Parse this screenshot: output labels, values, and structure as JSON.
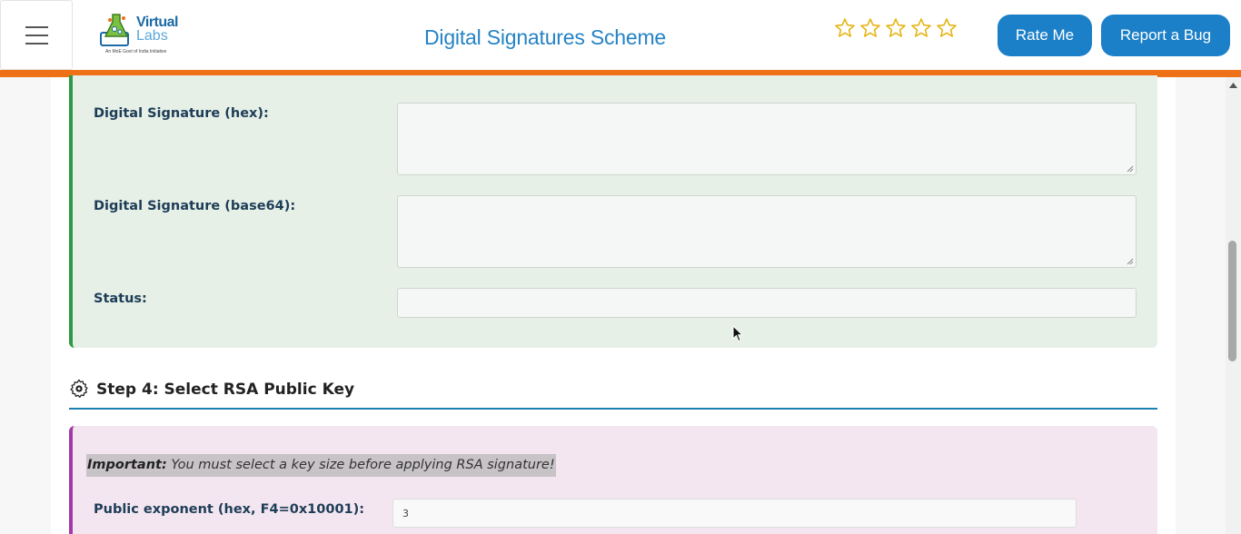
{
  "header": {
    "logo_line1": "Virtual",
    "logo_line2": "Labs",
    "logo_tagline": "An MoE Govt of India Initiative",
    "title": "Digital Signatures Scheme",
    "rating_stars": 5,
    "rate_button": "Rate Me",
    "bug_button": "Report a Bug"
  },
  "output_panel": {
    "sig_hex_label": "Digital Signature (hex):",
    "sig_hex_value": "",
    "sig_b64_label": "Digital Signature (base64):",
    "sig_b64_value": "",
    "status_label": "Status:",
    "status_value": ""
  },
  "step4": {
    "title": "Step 4: Select RSA Public Key",
    "important_bold": "Important:",
    "important_text": " You must select a key size before applying RSA signature!",
    "exponent_label": "Public exponent (hex, F4=0x10001):",
    "exponent_value": "3"
  },
  "colors": {
    "accent_orange": "#ee7017",
    "button_blue": "#1c80c8",
    "title_blue": "#2583c5",
    "green_border": "#2d9a45",
    "purple_border": "#a33aa8"
  }
}
